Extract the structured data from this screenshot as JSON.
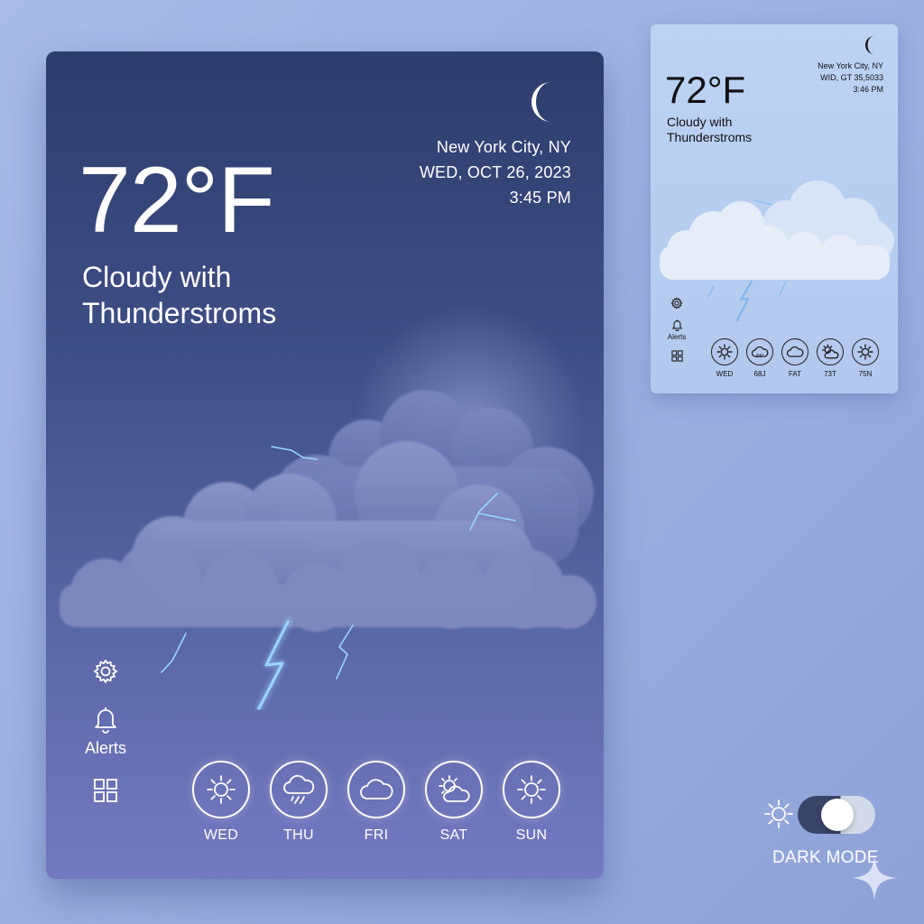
{
  "main_card": {
    "temperature": "72°F",
    "condition": "Cloudy with Thunderstroms",
    "location": "New York City, NY",
    "date": "WED, OCT 26, 2023",
    "time": "3:45 PM",
    "nav": {
      "alerts_label": "Alerts"
    },
    "forecast": [
      {
        "day": "WED",
        "icon": "sun-icon"
      },
      {
        "day": "THU",
        "icon": "rain-cloud-icon"
      },
      {
        "day": "FRI",
        "icon": "cloud-icon"
      },
      {
        "day": "SAT",
        "icon": "partly-cloudy-icon"
      },
      {
        "day": "SUN",
        "icon": "sun-icon"
      }
    ]
  },
  "mini_card": {
    "temperature": "72°F",
    "condition": "Cloudy with Thunderstroms",
    "location": "New York City, NY",
    "date": "WID, GT 35,5033",
    "time": "3:46 PM",
    "nav": {
      "alerts_label": "Alerts"
    },
    "forecast": [
      {
        "day": "WED",
        "icon": "sun-icon"
      },
      {
        "day": "68J",
        "icon": "cloud-icon",
        "badge": "2'5°"
      },
      {
        "day": "FAT",
        "icon": "cloud-icon"
      },
      {
        "day": "73T",
        "icon": "partly-cloudy-icon"
      },
      {
        "day": "75N",
        "icon": "sun-icon"
      }
    ]
  },
  "toggle": {
    "label": "DARK MODE",
    "state": "on"
  },
  "colors": {
    "card_dark_top": "#2d3d6c",
    "card_dark_bottom": "#7479c2",
    "card_light": "#bcd3f3",
    "lightning": "#8fd0ff",
    "toggle_track": "#3a4469"
  }
}
